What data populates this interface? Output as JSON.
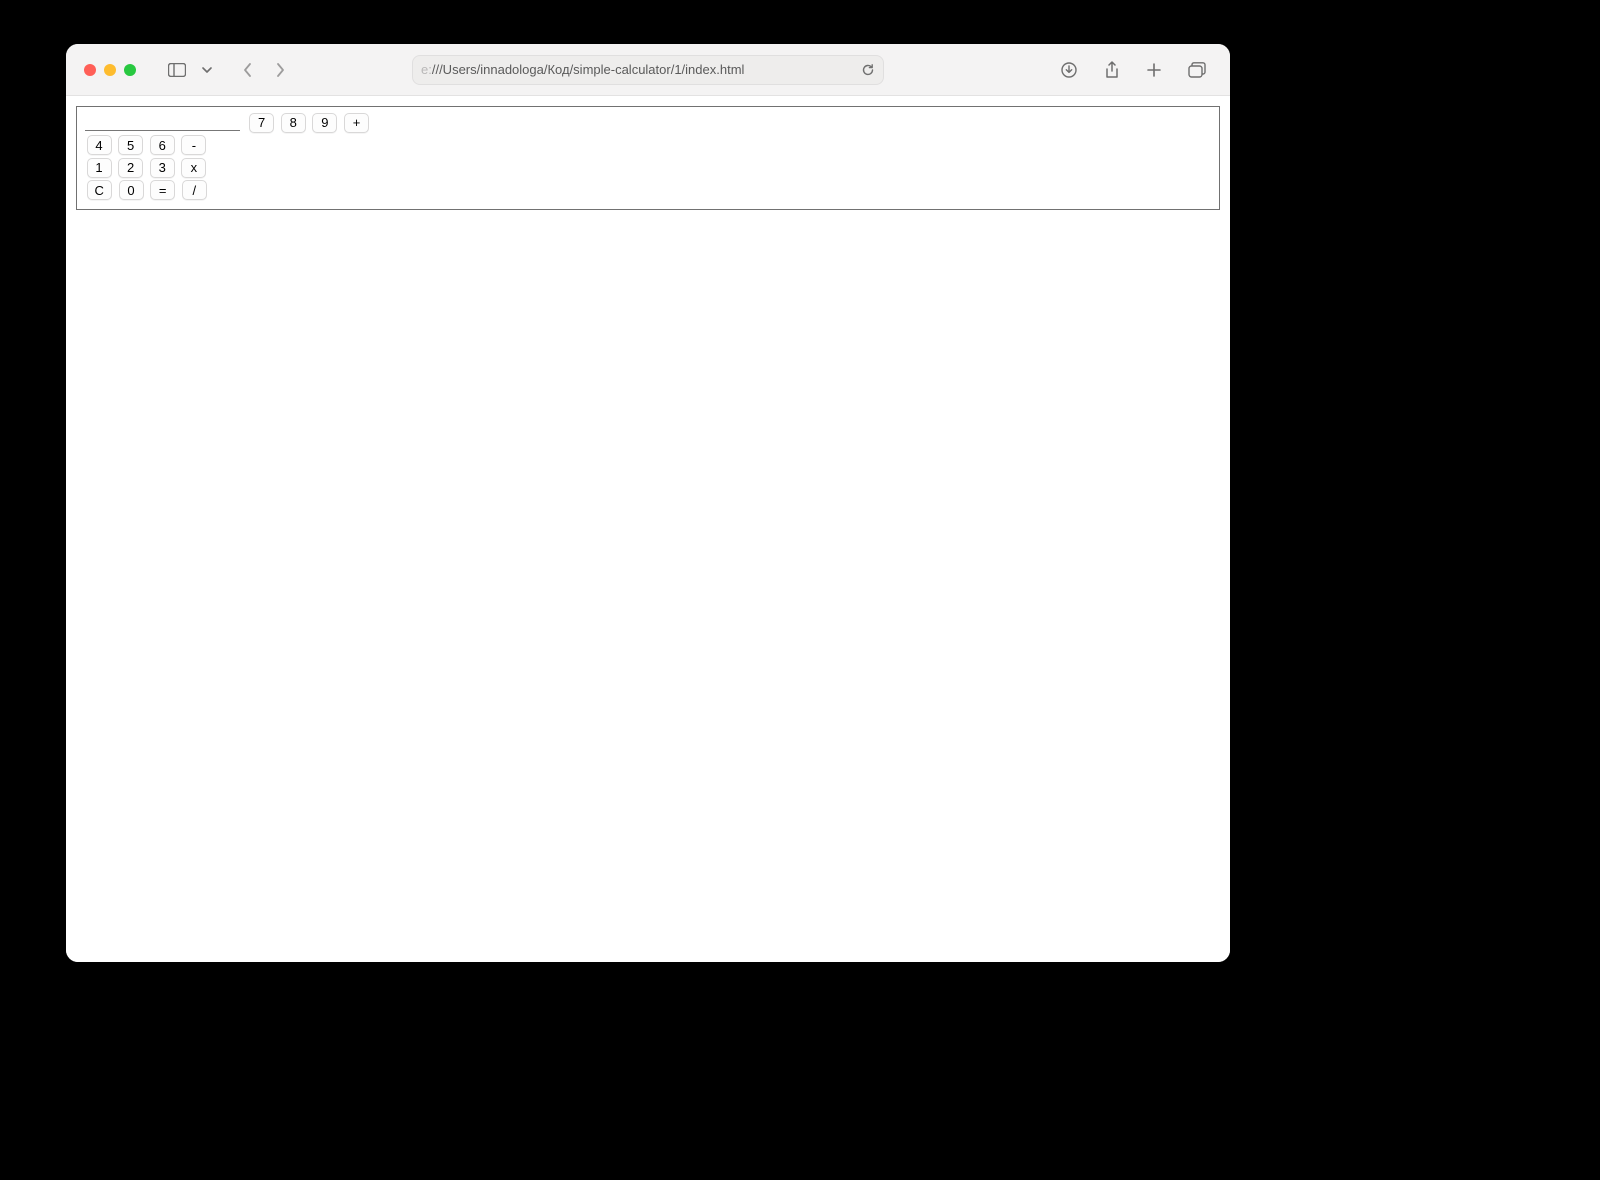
{
  "browser": {
    "url_prefix": "e:",
    "url_rest": "///Users/innadologa/Код/simple-calculator/1/index.html"
  },
  "calc": {
    "display_value": "",
    "rows": [
      [
        "7",
        "8",
        "9",
        "+"
      ],
      [
        "4",
        "5",
        "6",
        "-"
      ],
      [
        "1",
        "2",
        "3",
        "x"
      ],
      [
        "C",
        "0",
        "=",
        "/"
      ]
    ]
  }
}
